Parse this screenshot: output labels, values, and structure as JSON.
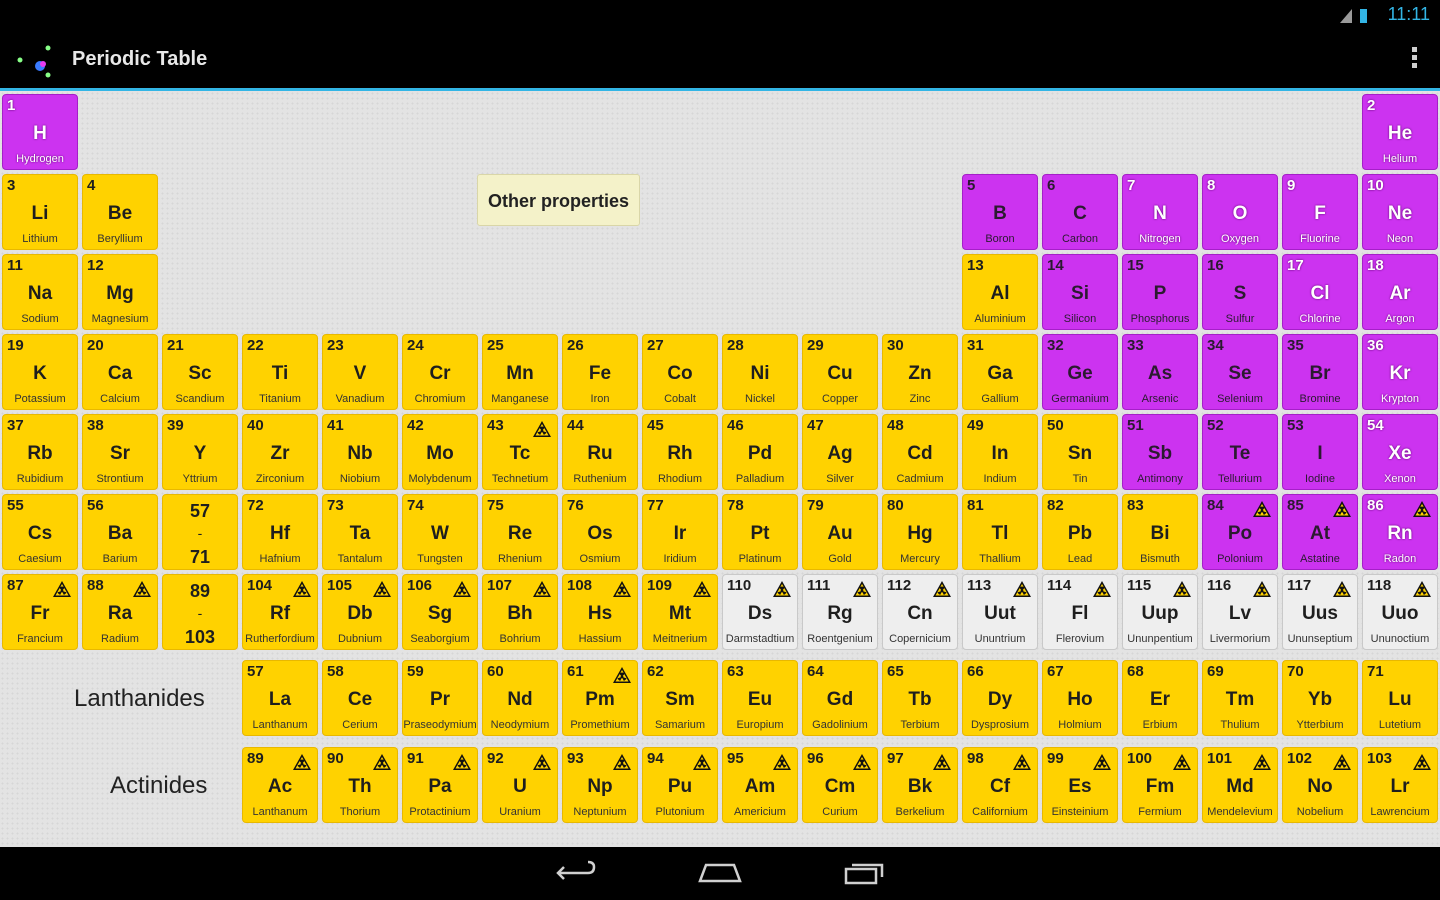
{
  "status_bar": {
    "time": "11:11"
  },
  "action_bar": {
    "title": "Periodic Table",
    "app_icon": "atom-icon",
    "overflow_icon": "overflow-menu-icon"
  },
  "other_properties_button": "Other properties",
  "labels": {
    "lanthanides": "Lanthanides",
    "actinides": "Actinides"
  },
  "nav_bar": {
    "back_icon": "back-icon",
    "home_icon": "home-icon",
    "recents_icon": "recent-apps-icon"
  },
  "colors": {
    "metal": "#ffd200",
    "nonmetal": "#cc33f0",
    "unknown": "#eeeeee",
    "accent": "#33b5e5"
  },
  "elements": [
    {
      "n": "1",
      "s": "H",
      "name": "Hydrogen",
      "type": "gas",
      "row": 1,
      "col": 1
    },
    {
      "n": "2",
      "s": "He",
      "name": "Helium",
      "type": "gas",
      "row": 1,
      "col": 18
    },
    {
      "n": "3",
      "s": "Li",
      "name": "Lithium",
      "type": "metal",
      "row": 2,
      "col": 1
    },
    {
      "n": "4",
      "s": "Be",
      "name": "Beryllium",
      "type": "metal",
      "row": 2,
      "col": 2
    },
    {
      "n": "5",
      "s": "B",
      "name": "Boron",
      "type": "nonmetal",
      "row": 2,
      "col": 13
    },
    {
      "n": "6",
      "s": "C",
      "name": "Carbon",
      "type": "nonmetal",
      "row": 2,
      "col": 14
    },
    {
      "n": "7",
      "s": "N",
      "name": "Nitrogen",
      "type": "gas",
      "row": 2,
      "col": 15
    },
    {
      "n": "8",
      "s": "O",
      "name": "Oxygen",
      "type": "gas",
      "row": 2,
      "col": 16
    },
    {
      "n": "9",
      "s": "F",
      "name": "Fluorine",
      "type": "gas",
      "row": 2,
      "col": 17
    },
    {
      "n": "10",
      "s": "Ne",
      "name": "Neon",
      "type": "gas",
      "row": 2,
      "col": 18
    },
    {
      "n": "11",
      "s": "Na",
      "name": "Sodium",
      "type": "metal",
      "row": 3,
      "col": 1
    },
    {
      "n": "12",
      "s": "Mg",
      "name": "Magnesium",
      "type": "metal",
      "row": 3,
      "col": 2
    },
    {
      "n": "13",
      "s": "Al",
      "name": "Aluminium",
      "type": "metal",
      "row": 3,
      "col": 13
    },
    {
      "n": "14",
      "s": "Si",
      "name": "Silicon",
      "type": "nonmetal",
      "row": 3,
      "col": 14
    },
    {
      "n": "15",
      "s": "P",
      "name": "Phosphorus",
      "type": "nonmetal",
      "row": 3,
      "col": 15
    },
    {
      "n": "16",
      "s": "S",
      "name": "Sulfur",
      "type": "nonmetal",
      "row": 3,
      "col": 16
    },
    {
      "n": "17",
      "s": "Cl",
      "name": "Chlorine",
      "type": "gas",
      "row": 3,
      "col": 17
    },
    {
      "n": "18",
      "s": "Ar",
      "name": "Argon",
      "type": "gas",
      "row": 3,
      "col": 18
    },
    {
      "n": "19",
      "s": "K",
      "name": "Potassium",
      "type": "metal",
      "row": 4,
      "col": 1
    },
    {
      "n": "20",
      "s": "Ca",
      "name": "Calcium",
      "type": "metal",
      "row": 4,
      "col": 2
    },
    {
      "n": "21",
      "s": "Sc",
      "name": "Scandium",
      "type": "metal",
      "row": 4,
      "col": 3
    },
    {
      "n": "22",
      "s": "Ti",
      "name": "Titanium",
      "type": "metal",
      "row": 4,
      "col": 4
    },
    {
      "n": "23",
      "s": "V",
      "name": "Vanadium",
      "type": "metal",
      "row": 4,
      "col": 5
    },
    {
      "n": "24",
      "s": "Cr",
      "name": "Chromium",
      "type": "metal",
      "row": 4,
      "col": 6
    },
    {
      "n": "25",
      "s": "Mn",
      "name": "Manganese",
      "type": "metal",
      "row": 4,
      "col": 7
    },
    {
      "n": "26",
      "s": "Fe",
      "name": "Iron",
      "type": "metal",
      "row": 4,
      "col": 8
    },
    {
      "n": "27",
      "s": "Co",
      "name": "Cobalt",
      "type": "metal",
      "row": 4,
      "col": 9
    },
    {
      "n": "28",
      "s": "Ni",
      "name": "Nickel",
      "type": "metal",
      "row": 4,
      "col": 10
    },
    {
      "n": "29",
      "s": "Cu",
      "name": "Copper",
      "type": "metal",
      "row": 4,
      "col": 11
    },
    {
      "n": "30",
      "s": "Zn",
      "name": "Zinc",
      "type": "metal",
      "row": 4,
      "col": 12
    },
    {
      "n": "31",
      "s": "Ga",
      "name": "Gallium",
      "type": "metal",
      "row": 4,
      "col": 13
    },
    {
      "n": "32",
      "s": "Ge",
      "name": "Germanium",
      "type": "nonmetal",
      "row": 4,
      "col": 14
    },
    {
      "n": "33",
      "s": "As",
      "name": "Arsenic",
      "type": "nonmetal",
      "row": 4,
      "col": 15
    },
    {
      "n": "34",
      "s": "Se",
      "name": "Selenium",
      "type": "nonmetal",
      "row": 4,
      "col": 16
    },
    {
      "n": "35",
      "s": "Br",
      "name": "Bromine",
      "type": "nonmetal",
      "row": 4,
      "col": 17
    },
    {
      "n": "36",
      "s": "Kr",
      "name": "Krypton",
      "type": "gas",
      "row": 4,
      "col": 18
    },
    {
      "n": "37",
      "s": "Rb",
      "name": "Rubidium",
      "type": "metal",
      "row": 5,
      "col": 1
    },
    {
      "n": "38",
      "s": "Sr",
      "name": "Strontium",
      "type": "metal",
      "row": 5,
      "col": 2
    },
    {
      "n": "39",
      "s": "Y",
      "name": "Yttrium",
      "type": "metal",
      "row": 5,
      "col": 3
    },
    {
      "n": "40",
      "s": "Zr",
      "name": "Zirconium",
      "type": "metal",
      "row": 5,
      "col": 4
    },
    {
      "n": "41",
      "s": "Nb",
      "name": "Niobium",
      "type": "metal",
      "row": 5,
      "col": 5
    },
    {
      "n": "42",
      "s": "Mo",
      "name": "Molybdenum",
      "type": "metal",
      "row": 5,
      "col": 6
    },
    {
      "n": "43",
      "s": "Tc",
      "name": "Technetium",
      "type": "metal",
      "row": 5,
      "col": 7,
      "rad": true
    },
    {
      "n": "44",
      "s": "Ru",
      "name": "Ruthenium",
      "type": "metal",
      "row": 5,
      "col": 8
    },
    {
      "n": "45",
      "s": "Rh",
      "name": "Rhodium",
      "type": "metal",
      "row": 5,
      "col": 9
    },
    {
      "n": "46",
      "s": "Pd",
      "name": "Palladium",
      "type": "metal",
      "row": 5,
      "col": 10
    },
    {
      "n": "47",
      "s": "Ag",
      "name": "Silver",
      "type": "metal",
      "row": 5,
      "col": 11
    },
    {
      "n": "48",
      "s": "Cd",
      "name": "Cadmium",
      "type": "metal",
      "row": 5,
      "col": 12
    },
    {
      "n": "49",
      "s": "In",
      "name": "Indium",
      "type": "metal",
      "row": 5,
      "col": 13
    },
    {
      "n": "50",
      "s": "Sn",
      "name": "Tin",
      "type": "metal",
      "row": 5,
      "col": 14
    },
    {
      "n": "51",
      "s": "Sb",
      "name": "Antimony",
      "type": "nonmetal",
      "row": 5,
      "col": 15
    },
    {
      "n": "52",
      "s": "Te",
      "name": "Tellurium",
      "type": "nonmetal",
      "row": 5,
      "col": 16
    },
    {
      "n": "53",
      "s": "I",
      "name": "Iodine",
      "type": "nonmetal",
      "row": 5,
      "col": 17
    },
    {
      "n": "54",
      "s": "Xe",
      "name": "Xenon",
      "type": "gas",
      "row": 5,
      "col": 18
    },
    {
      "n": "55",
      "s": "Cs",
      "name": "Caesium",
      "type": "metal",
      "row": 6,
      "col": 1
    },
    {
      "n": "56",
      "s": "Ba",
      "name": "Barium",
      "type": "metal",
      "row": 6,
      "col": 2
    },
    {
      "n": "57",
      "s": "71",
      "name": "",
      "type": "metal",
      "row": 6,
      "col": 3,
      "range": true
    },
    {
      "n": "72",
      "s": "Hf",
      "name": "Hafnium",
      "type": "metal",
      "row": 6,
      "col": 4
    },
    {
      "n": "73",
      "s": "Ta",
      "name": "Tantalum",
      "type": "metal",
      "row": 6,
      "col": 5
    },
    {
      "n": "74",
      "s": "W",
      "name": "Tungsten",
      "type": "metal",
      "row": 6,
      "col": 6
    },
    {
      "n": "75",
      "s": "Re",
      "name": "Rhenium",
      "type": "metal",
      "row": 6,
      "col": 7
    },
    {
      "n": "76",
      "s": "Os",
      "name": "Osmium",
      "type": "metal",
      "row": 6,
      "col": 8
    },
    {
      "n": "77",
      "s": "Ir",
      "name": "Iridium",
      "type": "metal",
      "row": 6,
      "col": 9
    },
    {
      "n": "78",
      "s": "Pt",
      "name": "Platinum",
      "type": "metal",
      "row": 6,
      "col": 10
    },
    {
      "n": "79",
      "s": "Au",
      "name": "Gold",
      "type": "metal",
      "row": 6,
      "col": 11
    },
    {
      "n": "80",
      "s": "Hg",
      "name": "Mercury",
      "type": "metal",
      "row": 6,
      "col": 12
    },
    {
      "n": "81",
      "s": "Tl",
      "name": "Thallium",
      "type": "metal",
      "row": 6,
      "col": 13
    },
    {
      "n": "82",
      "s": "Pb",
      "name": "Lead",
      "type": "metal",
      "row": 6,
      "col": 14
    },
    {
      "n": "83",
      "s": "Bi",
      "name": "Bismuth",
      "type": "metal",
      "row": 6,
      "col": 15
    },
    {
      "n": "84",
      "s": "Po",
      "name": "Polonium",
      "type": "nonmetal",
      "row": 6,
      "col": 16,
      "rad": true
    },
    {
      "n": "85",
      "s": "At",
      "name": "Astatine",
      "type": "nonmetal",
      "row": 6,
      "col": 17,
      "rad": true
    },
    {
      "n": "86",
      "s": "Rn",
      "name": "Radon",
      "type": "gas",
      "row": 6,
      "col": 18,
      "rad": true
    },
    {
      "n": "87",
      "s": "Fr",
      "name": "Francium",
      "type": "metal",
      "row": 7,
      "col": 1,
      "rad": true
    },
    {
      "n": "88",
      "s": "Ra",
      "name": "Radium",
      "type": "metal",
      "row": 7,
      "col": 2,
      "rad": true
    },
    {
      "n": "89",
      "s": "103",
      "name": "",
      "type": "metal",
      "row": 7,
      "col": 3,
      "range": true
    },
    {
      "n": "104",
      "s": "Rf",
      "name": "Rutherfordium",
      "type": "metal",
      "row": 7,
      "col": 4,
      "rad": true
    },
    {
      "n": "105",
      "s": "Db",
      "name": "Dubnium",
      "type": "metal",
      "row": 7,
      "col": 5,
      "rad": true
    },
    {
      "n": "106",
      "s": "Sg",
      "name": "Seaborgium",
      "type": "metal",
      "row": 7,
      "col": 6,
      "rad": true
    },
    {
      "n": "107",
      "s": "Bh",
      "name": "Bohrium",
      "type": "metal",
      "row": 7,
      "col": 7,
      "rad": true
    },
    {
      "n": "108",
      "s": "Hs",
      "name": "Hassium",
      "type": "metal",
      "row": 7,
      "col": 8,
      "rad": true
    },
    {
      "n": "109",
      "s": "Mt",
      "name": "Meitnerium",
      "type": "metal",
      "row": 7,
      "col": 9,
      "rad": true
    },
    {
      "n": "110",
      "s": "Ds",
      "name": "Darmstadtium",
      "type": "unknown",
      "row": 7,
      "col": 10,
      "rad": true
    },
    {
      "n": "111",
      "s": "Rg",
      "name": "Roentgenium",
      "type": "unknown",
      "row": 7,
      "col": 11,
      "rad": true
    },
    {
      "n": "112",
      "s": "Cn",
      "name": "Copernicium",
      "type": "unknown",
      "row": 7,
      "col": 12,
      "rad": true
    },
    {
      "n": "113",
      "s": "Uut",
      "name": "Ununtrium",
      "type": "unknown",
      "row": 7,
      "col": 13,
      "rad": true
    },
    {
      "n": "114",
      "s": "Fl",
      "name": "Flerovium",
      "type": "unknown",
      "row": 7,
      "col": 14,
      "rad": true
    },
    {
      "n": "115",
      "s": "Uup",
      "name": "Ununpentium",
      "type": "unknown",
      "row": 7,
      "col": 15,
      "rad": true
    },
    {
      "n": "116",
      "s": "Lv",
      "name": "Livermorium",
      "type": "unknown",
      "row": 7,
      "col": 16,
      "rad": true
    },
    {
      "n": "117",
      "s": "Uus",
      "name": "Ununseptium",
      "type": "unknown",
      "row": 7,
      "col": 17,
      "rad": true
    },
    {
      "n": "118",
      "s": "Uuo",
      "name": "Ununoctium",
      "type": "unknown",
      "row": 7,
      "col": 18,
      "rad": true
    },
    {
      "n": "57",
      "s": "La",
      "name": "Lanthanum",
      "type": "metal",
      "row": 8,
      "col": 4
    },
    {
      "n": "58",
      "s": "Ce",
      "name": "Cerium",
      "type": "metal",
      "row": 8,
      "col": 5
    },
    {
      "n": "59",
      "s": "Pr",
      "name": "Praseodymium",
      "type": "metal",
      "row": 8,
      "col": 6
    },
    {
      "n": "60",
      "s": "Nd",
      "name": "Neodymium",
      "type": "metal",
      "row": 8,
      "col": 7
    },
    {
      "n": "61",
      "s": "Pm",
      "name": "Promethium",
      "type": "metal",
      "row": 8,
      "col": 8,
      "rad": true
    },
    {
      "n": "62",
      "s": "Sm",
      "name": "Samarium",
      "type": "metal",
      "row": 8,
      "col": 9
    },
    {
      "n": "63",
      "s": "Eu",
      "name": "Europium",
      "type": "metal",
      "row": 8,
      "col": 10
    },
    {
      "n": "64",
      "s": "Gd",
      "name": "Gadolinium",
      "type": "metal",
      "row": 8,
      "col": 11
    },
    {
      "n": "65",
      "s": "Tb",
      "name": "Terbium",
      "type": "metal",
      "row": 8,
      "col": 12
    },
    {
      "n": "66",
      "s": "Dy",
      "name": "Dysprosium",
      "type": "metal",
      "row": 8,
      "col": 13
    },
    {
      "n": "67",
      "s": "Ho",
      "name": "Holmium",
      "type": "metal",
      "row": 8,
      "col": 14
    },
    {
      "n": "68",
      "s": "Er",
      "name": "Erbium",
      "type": "metal",
      "row": 8,
      "col": 15
    },
    {
      "n": "69",
      "s": "Tm",
      "name": "Thulium",
      "type": "metal",
      "row": 8,
      "col": 16
    },
    {
      "n": "70",
      "s": "Yb",
      "name": "Ytterbium",
      "type": "metal",
      "row": 8,
      "col": 17
    },
    {
      "n": "71",
      "s": "Lu",
      "name": "Lutetium",
      "type": "metal",
      "row": 8,
      "col": 18
    },
    {
      "n": "89",
      "s": "Ac",
      "name": "Lanthanum",
      "type": "metal",
      "row": 9,
      "col": 4,
      "rad": true
    },
    {
      "n": "90",
      "s": "Th",
      "name": "Thorium",
      "type": "metal",
      "row": 9,
      "col": 5,
      "rad": true
    },
    {
      "n": "91",
      "s": "Pa",
      "name": "Protactinium",
      "type": "metal",
      "row": 9,
      "col": 6,
      "rad": true
    },
    {
      "n": "92",
      "s": "U",
      "name": "Uranium",
      "type": "metal",
      "row": 9,
      "col": 7,
      "rad": true
    },
    {
      "n": "93",
      "s": "Np",
      "name": "Neptunium",
      "type": "metal",
      "row": 9,
      "col": 8,
      "rad": true
    },
    {
      "n": "94",
      "s": "Pu",
      "name": "Plutonium",
      "type": "metal",
      "row": 9,
      "col": 9,
      "rad": true
    },
    {
      "n": "95",
      "s": "Am",
      "name": "Americium",
      "type": "metal",
      "row": 9,
      "col": 10,
      "rad": true
    },
    {
      "n": "96",
      "s": "Cm",
      "name": "Curium",
      "type": "metal",
      "row": 9,
      "col": 11,
      "rad": true
    },
    {
      "n": "97",
      "s": "Bk",
      "name": "Berkelium",
      "type": "metal",
      "row": 9,
      "col": 12,
      "rad": true
    },
    {
      "n": "98",
      "s": "Cf",
      "name": "Californium",
      "type": "metal",
      "row": 9,
      "col": 13,
      "rad": true
    },
    {
      "n": "99",
      "s": "Es",
      "name": "Einsteinium",
      "type": "metal",
      "row": 9,
      "col": 14,
      "rad": true
    },
    {
      "n": "100",
      "s": "Fm",
      "name": "Fermium",
      "type": "metal",
      "row": 9,
      "col": 15,
      "rad": true
    },
    {
      "n": "101",
      "s": "Md",
      "name": "Mendelevium",
      "type": "metal",
      "row": 9,
      "col": 16,
      "rad": true
    },
    {
      "n": "102",
      "s": "No",
      "name": "Nobelium",
      "type": "metal",
      "row": 9,
      "col": 17,
      "rad": true
    },
    {
      "n": "103",
      "s": "Lr",
      "name": "Lawrencium",
      "type": "metal",
      "row": 9,
      "col": 18,
      "rad": true
    }
  ]
}
